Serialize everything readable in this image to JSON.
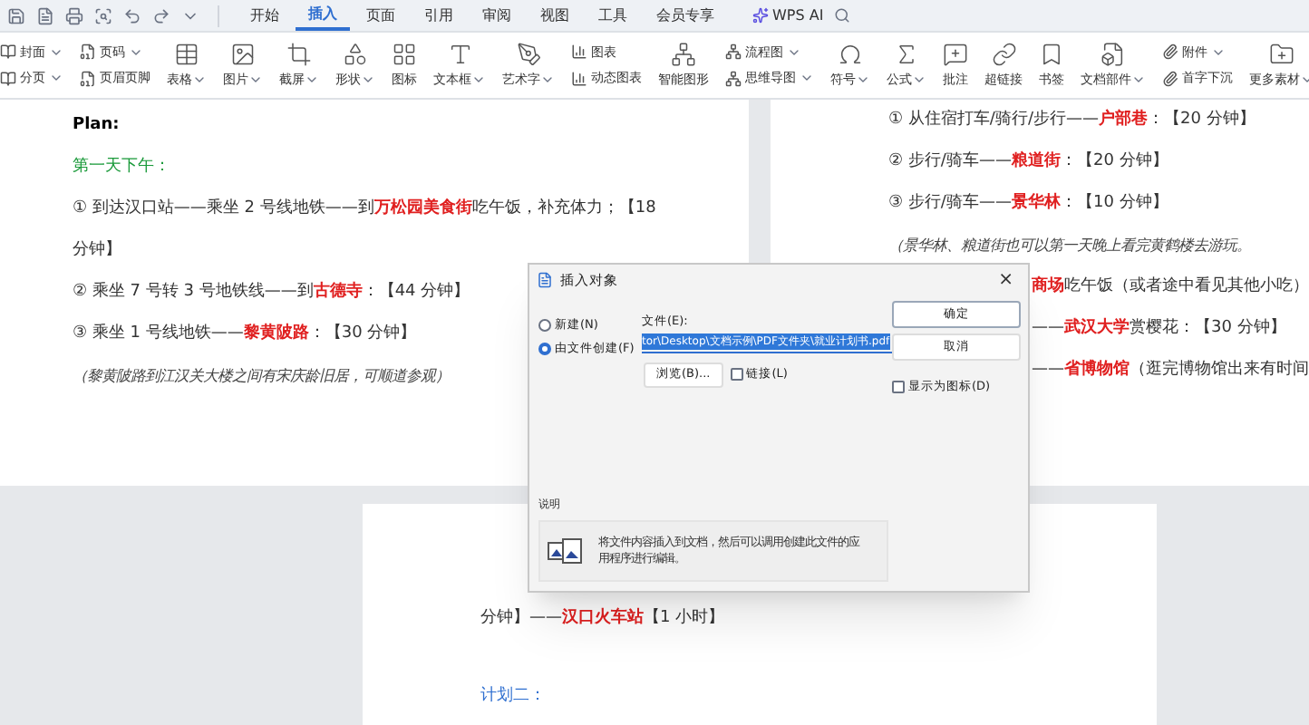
{
  "menu_tabs": [
    {
      "label": "开始",
      "selected": false
    },
    {
      "label": "插入",
      "selected": true
    },
    {
      "label": "页面",
      "selected": false
    },
    {
      "label": "引用",
      "selected": false
    },
    {
      "label": "审阅",
      "selected": false
    },
    {
      "label": "视图",
      "selected": false
    },
    {
      "label": "工具",
      "selected": false
    },
    {
      "label": "会员专享",
      "selected": false
    }
  ],
  "ai_button": "WPS AI",
  "ribbon": [
    {
      "kind": "stack",
      "items": [
        {
          "label": "封面",
          "menu": true
        },
        {
          "label": "分页",
          "menu": true
        }
      ]
    },
    {
      "kind": "stack",
      "items": [
        {
          "label": "页码",
          "menu": true
        },
        {
          "label": "页眉页脚",
          "menu": false
        }
      ]
    },
    {
      "kind": "large",
      "label": "表格",
      "menu": true
    },
    {
      "kind": "large",
      "label": "图片",
      "menu": true
    },
    {
      "kind": "large",
      "label": "截屏",
      "menu": true
    },
    {
      "kind": "large",
      "label": "形状",
      "menu": true
    },
    {
      "kind": "large",
      "label": "图标",
      "menu": false
    },
    {
      "kind": "large",
      "label": "文本框",
      "menu": true
    },
    {
      "kind": "large",
      "label": "艺术字",
      "menu": true
    },
    {
      "kind": "stack",
      "items": [
        {
          "label": "图表",
          "menu": false
        },
        {
          "label": "动态图表",
          "menu": false
        }
      ]
    },
    {
      "kind": "large",
      "label": "智能图形",
      "menu": false
    },
    {
      "kind": "stack",
      "items": [
        {
          "label": "流程图",
          "menu": true
        },
        {
          "label": "思维导图",
          "menu": true
        }
      ]
    },
    {
      "kind": "large",
      "label": "符号",
      "menu": true
    },
    {
      "kind": "large",
      "label": "公式",
      "menu": true
    },
    {
      "kind": "large",
      "label": "批注",
      "menu": false
    },
    {
      "kind": "large",
      "label": "超链接",
      "menu": false
    },
    {
      "kind": "large",
      "label": "书签",
      "menu": false
    },
    {
      "kind": "large",
      "label": "文档部件",
      "menu": true
    },
    {
      "kind": "stack",
      "items": [
        {
          "label": "附件",
          "menu": true
        },
        {
          "label": "首字下沉",
          "menu": false
        }
      ]
    },
    {
      "kind": "large",
      "label": "更多素材",
      "menu": true
    }
  ],
  "left_page": [
    {
      "kind": "bold",
      "text": "Plan:"
    },
    {
      "kind": "green",
      "text": "第一天下午："
    },
    {
      "kind": "plain",
      "text": "① 到达汉口站——乘坐 2 号线地铁——到**万松园美食街**吃午饭，补充体力；【18"
    },
    {
      "kind": "plain",
      "text": "分钟】"
    },
    {
      "kind": "plain",
      "text": "② 乘坐 7 号转 3 号地铁线——到**古德寺**：【44 分钟】"
    },
    {
      "kind": "plain",
      "text": "③ 乘坐 1 号线地铁——**黎黄陂路**：【30 分钟】"
    },
    {
      "kind": "note",
      "text": "（黎黄陂路到江汉关大楼之间有宋庆龄旧居，可顺道参观）"
    }
  ],
  "right_page": [
    {
      "kind": "plain",
      "text": "① 从住宿打车/骑行/步行——**户部巷**：【20 分钟】"
    },
    {
      "kind": "plain",
      "text": "② 步行/骑车——**粮道街**：【20 分钟】"
    },
    {
      "kind": "plain",
      "text": "③ 步行/骑车——**景华林**：【10 分钟】"
    },
    {
      "kind": "note",
      "text": "（景华林、粮道街也可以第一天晚上看完黄鹤楼去游玩。"
    },
    {
      "kind": "partial",
      "text": "**商场**吃午饭（或者途中看见其他小吃）"
    },
    {
      "kind": "partial",
      "text": "——**武汉大学**赏樱花：【30 分钟】"
    },
    {
      "kind": "partial",
      "text": "——**省博物馆**（逛完博物馆出来有时间"
    }
  ],
  "bottom_page": [
    {
      "kind": "plain",
      "text": "分钟】——**汉口火车站**【1 小时】"
    },
    {
      "kind": "blue",
      "text": "计划二："
    }
  ],
  "dialog": {
    "title": "插入对象",
    "close": "×",
    "options": [
      {
        "label": "新建(N)",
        "selected": false
      },
      {
        "label": "由文件创建(F)",
        "selected": true
      }
    ],
    "file_label": "文件(E):",
    "file_value": "tor\\Desktop\\文档示例\\PDF文件夹\\就业计划书.pdf",
    "browse": "浏览(B)...",
    "link": {
      "label": "链接(L)",
      "checked": false
    },
    "ok": "确定",
    "cancel": "取消",
    "show_icon": {
      "label": "显示为图标(D)",
      "checked": false
    },
    "desc_title": "说明",
    "desc": "将文件内容插入到文档，然后可以调用创建此文件的应用程序进行编辑。"
  }
}
